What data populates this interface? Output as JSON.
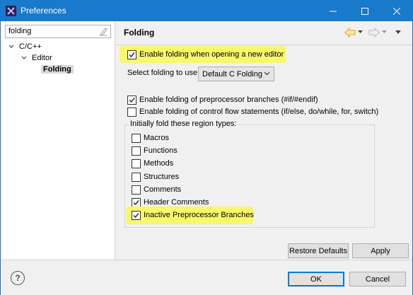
{
  "window": {
    "title": "Preferences",
    "icon": "eclipse-x-icon",
    "controls": [
      "minimize-icon",
      "maximize-icon",
      "close-icon"
    ]
  },
  "sidebar": {
    "filter_value": "folding",
    "tree": [
      {
        "label": "C/C++",
        "expanded": true,
        "level": 0
      },
      {
        "label": "Editor",
        "expanded": true,
        "level": 1
      },
      {
        "label": "Folding",
        "selected": true,
        "level": 2
      }
    ]
  },
  "page": {
    "title": "Folding",
    "enable_folding": {
      "label": "Enable folding when opening a new editor",
      "checked": true,
      "highlighted": true
    },
    "select_folding": {
      "label": "Select folding to use:",
      "value": "Default C Folding"
    },
    "preprocessor": {
      "label": "Enable folding of preprocessor branches (#if/#endif)",
      "checked": true
    },
    "control_flow": {
      "label": "Enable folding of control flow statements (if/else, do/while, for, switch)",
      "checked": false
    },
    "group_title": "Initially fold these region types:",
    "region_types": [
      {
        "label": "Macros",
        "checked": false
      },
      {
        "label": "Functions",
        "checked": false
      },
      {
        "label": "Methods",
        "checked": false
      },
      {
        "label": "Structures",
        "checked": false
      },
      {
        "label": "Comments",
        "checked": false
      },
      {
        "label": "Header Comments",
        "checked": true
      },
      {
        "label": "Inactive Preprocessor Branches",
        "checked": true,
        "highlighted": true
      }
    ],
    "restore_defaults": "Restore Defaults",
    "apply": "Apply"
  },
  "footer": {
    "help": "?",
    "ok": "OK",
    "cancel": "Cancel"
  },
  "colors": {
    "titlebar": "#1979ca",
    "highlight": "#f8f86a",
    "nav_arrow": "#e8a317"
  }
}
